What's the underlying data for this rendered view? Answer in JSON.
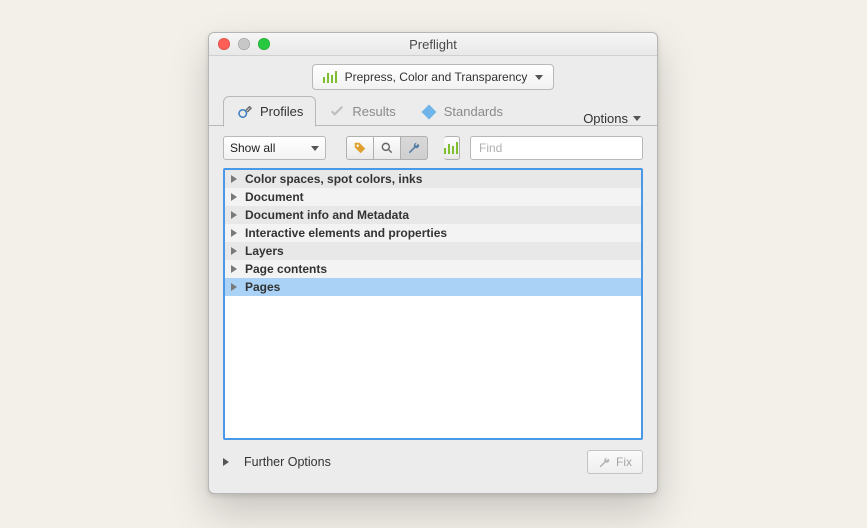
{
  "window": {
    "title": "Preflight"
  },
  "category": {
    "label": "Prepress, Color and Transparency"
  },
  "tabs": {
    "profiles": "Profiles",
    "results": "Results",
    "standards": "Standards",
    "options": "Options"
  },
  "filter": {
    "select": "Show all",
    "search_placeholder": "Find"
  },
  "groups": [
    "Color spaces, spot colors, inks",
    "Document",
    "Document info and Metadata",
    "Interactive elements and properties",
    "Layers",
    "Page contents",
    "Pages"
  ],
  "footer": {
    "further": "Further Options",
    "fix": "Fix"
  }
}
